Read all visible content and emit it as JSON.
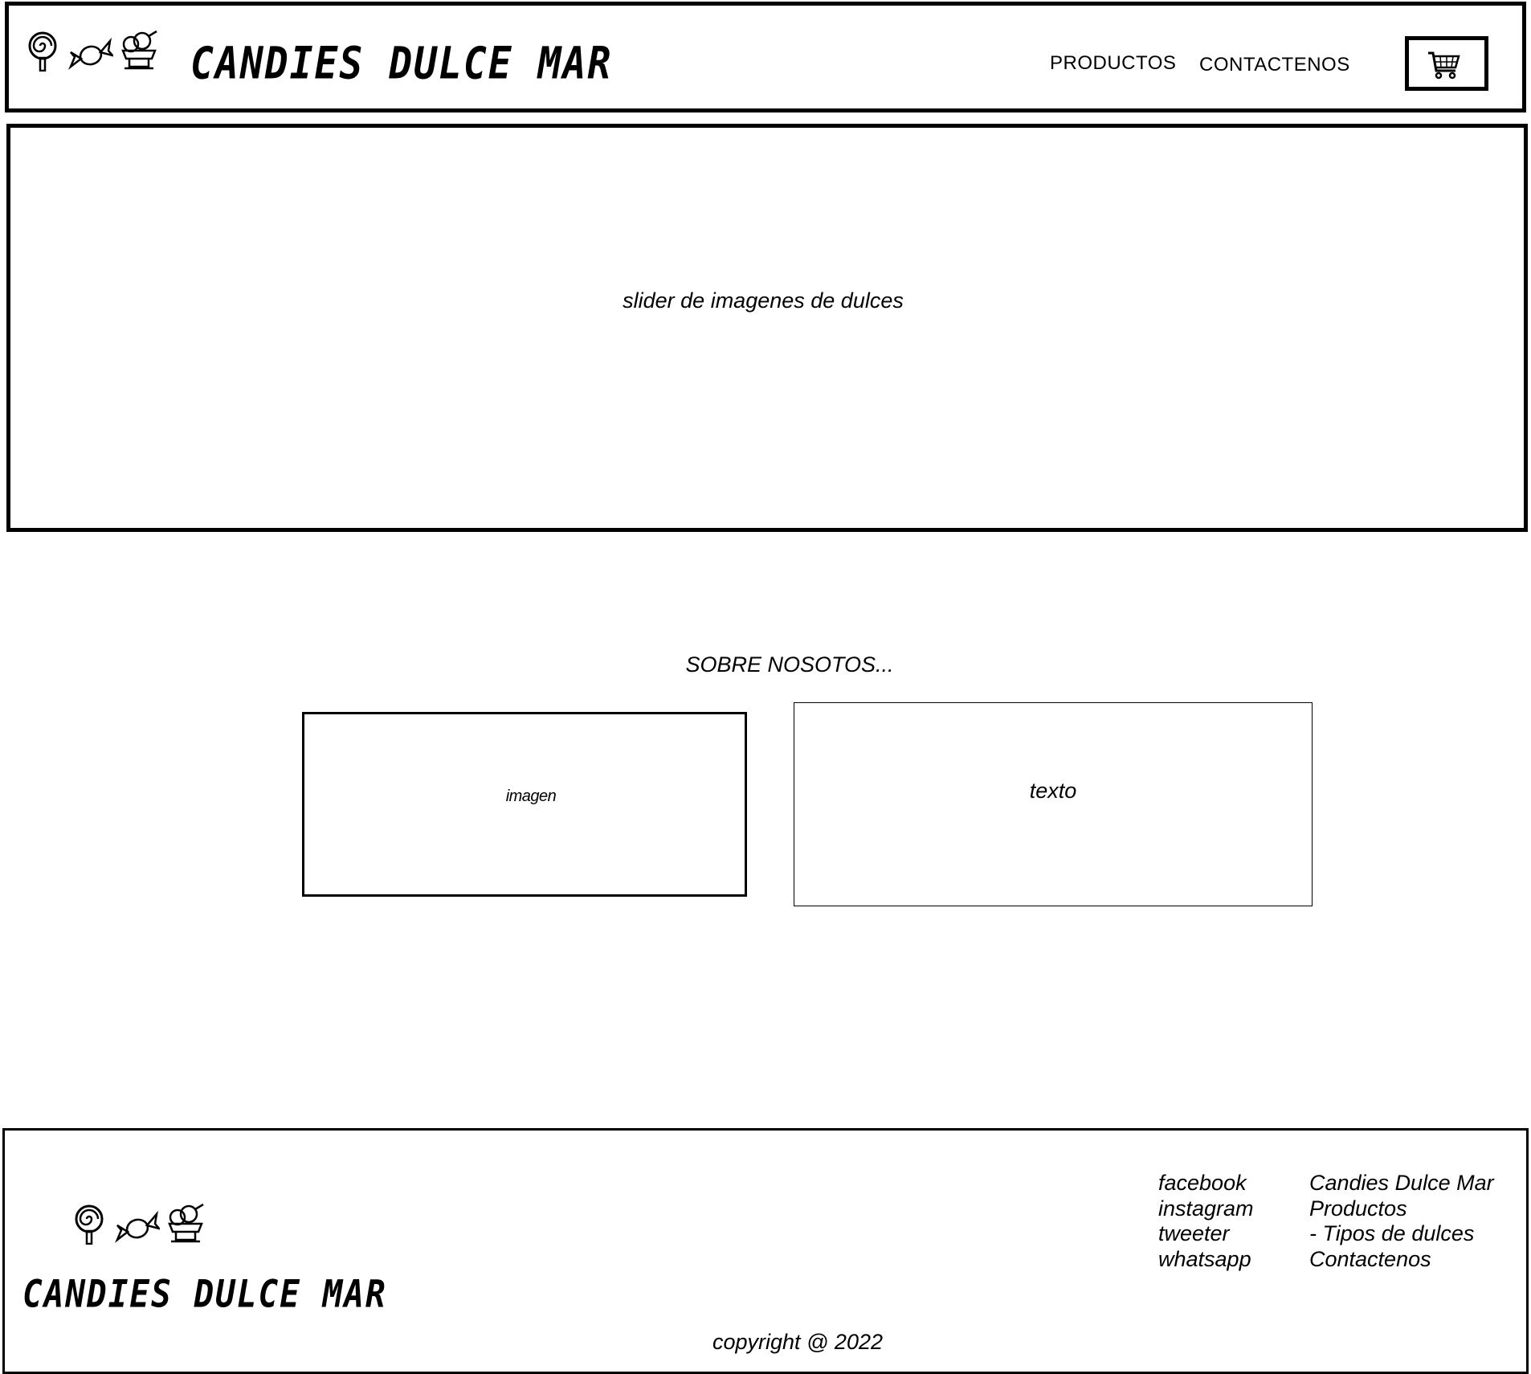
{
  "header": {
    "brand": "CANDIES DULCE MAR",
    "logo_icons": [
      "lollipop-icon",
      "candy-icon",
      "ice-cream-icon"
    ],
    "nav": {
      "productos": "PRODUCTOS",
      "contactenos": "CONTACTENOS"
    },
    "cart_icon": "shopping-cart-icon"
  },
  "slider": {
    "label": "slider de imagenes de dulces"
  },
  "about": {
    "heading": "SOBRE NOSOTOS...",
    "image_label": "imagen",
    "text_label": "texto"
  },
  "footer": {
    "brand": "CANDIES DULCE MAR",
    "social": [
      "facebook",
      "instagram",
      "tweeter",
      "whatsapp"
    ],
    "sitemap": [
      "Candies Dulce Mar",
      "Productos",
      "- Tipos de dulces",
      "Contactenos"
    ],
    "copyright": "copyright @ 2022"
  }
}
